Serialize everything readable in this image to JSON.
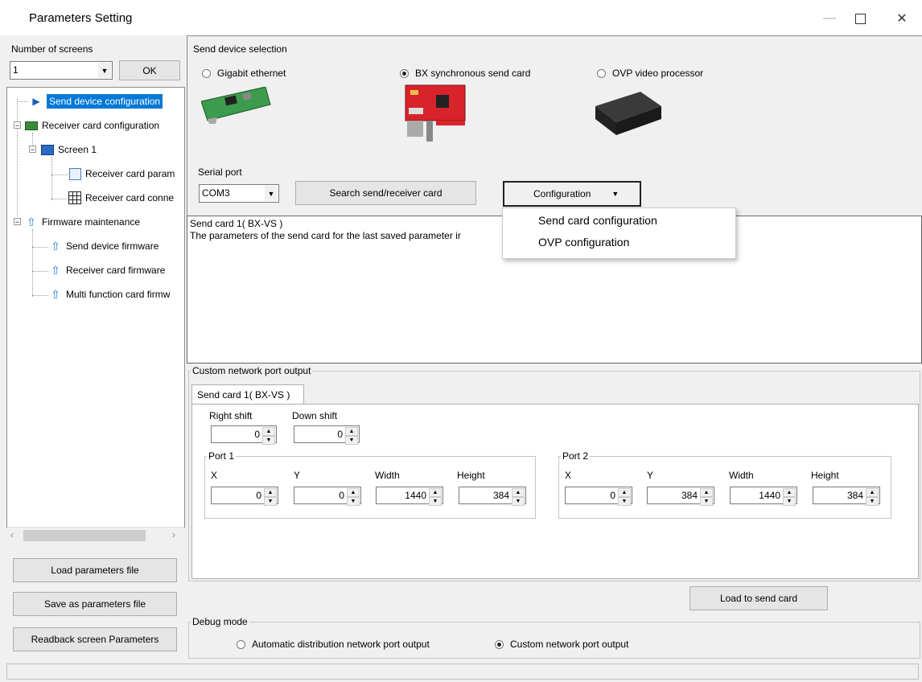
{
  "window": {
    "title": "Parameters Setting",
    "minimize_icon": "minimize-icon",
    "maximize_icon": "maximize-icon",
    "close_icon": "close-icon"
  },
  "left_panel": {
    "screens_label": "Number of screens",
    "screens_value": "1",
    "ok_label": "OK",
    "tree": [
      {
        "label": "Send device configuration",
        "icon": "play-arrow-icon",
        "selected": true
      },
      {
        "label": "Receiver card configuration",
        "icon": "card-icon"
      },
      {
        "label": "Screen 1",
        "icon": "monitor-icon"
      },
      {
        "label": "Receiver card param",
        "icon": "list-icon"
      },
      {
        "label": "Receiver card conne",
        "icon": "grid-icon"
      },
      {
        "label": "Firmware maintenance",
        "icon": "upload-folder-icon"
      },
      {
        "label": "Send device firmware",
        "icon": "upload-arrow-icon"
      },
      {
        "label": "Receiver card firmware",
        "icon": "upload-arrow-icon"
      },
      {
        "label": "Multi function card firmw",
        "icon": "upload-arrow-icon"
      }
    ],
    "load_file": "Load parameters file",
    "save_file": "Save as parameters file",
    "readback": "Readback screen Parameters"
  },
  "send_device": {
    "section_label": "Send device selection",
    "options": [
      {
        "label": "Gigabit ethernet",
        "checked": false
      },
      {
        "label": "BX synchronous send card",
        "checked": true
      },
      {
        "label": "OVP video processor",
        "checked": false
      }
    ],
    "serial_label": "Serial port",
    "serial_value": "COM3",
    "search_button": "Search send/receiver card",
    "config_button": "Configuration"
  },
  "dropdown": {
    "items": [
      "Send card configuration",
      "OVP configuration"
    ]
  },
  "info": {
    "line1": "Send card 1( BX-VS )",
    "line2": "The parameters of the send card for the last saved parameter ir"
  },
  "custom_output": {
    "group_label": "Custom network port output",
    "tab_label": "Send card 1( BX-VS )",
    "right_shift_label": "Right shift",
    "right_shift_value": "0",
    "down_shift_label": "Down shift",
    "down_shift_value": "0",
    "ports": [
      {
        "label": "Port 1",
        "x": "0",
        "y": "0",
        "width": "1440",
        "height": "384"
      },
      {
        "label": "Port 2",
        "x": "0",
        "y": "384",
        "width": "1440",
        "height": "384"
      }
    ],
    "x_label": "X",
    "y_label": "Y",
    "width_label": "Width",
    "height_label": "Height",
    "load_button": "Load to send card"
  },
  "debug": {
    "group_label": "Debug mode",
    "options": [
      {
        "label": "Automatic distribution network port output",
        "checked": false
      },
      {
        "label": "Custom network port output",
        "checked": true
      }
    ]
  },
  "colors": {
    "selection": "#0078d7",
    "card_red": "#d8232a",
    "card_green": "#3a8a3a"
  }
}
